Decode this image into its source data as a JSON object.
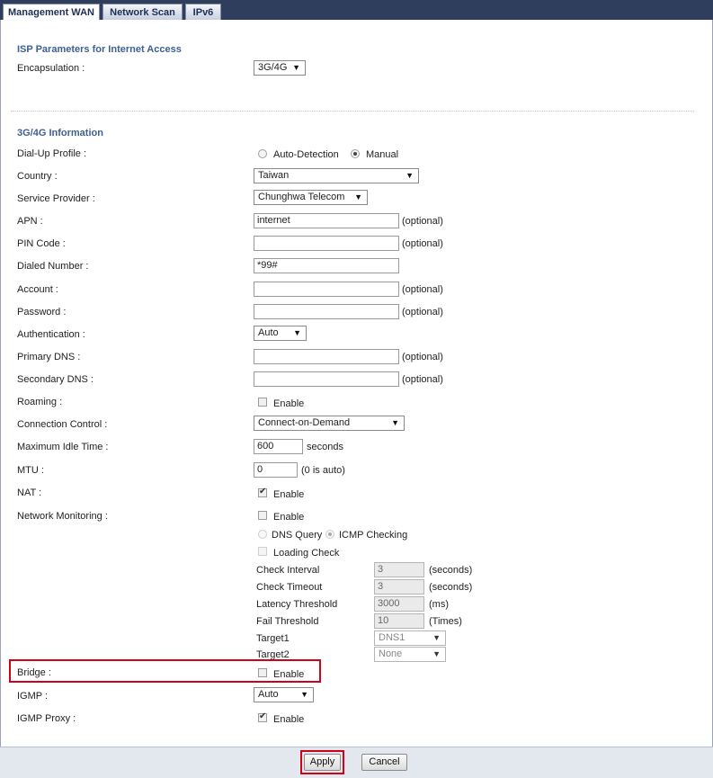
{
  "tabs": [
    {
      "label": "Management WAN",
      "active": true
    },
    {
      "label": "Network Scan",
      "active": false
    },
    {
      "label": "IPv6",
      "active": false
    }
  ],
  "isp": {
    "title": "ISP Parameters for Internet Access",
    "encapsulation_label": "Encapsulation :",
    "encapsulation_value": "3G/4G"
  },
  "info": {
    "title": "3G/4G Information",
    "dialup_label": "Dial-Up Profile :",
    "dialup_auto": "Auto-Detection",
    "dialup_manual": "Manual",
    "country_label": "Country :",
    "country_value": "Taiwan",
    "provider_label": "Service Provider :",
    "provider_value": "Chunghwa Telecom",
    "apn_label": "APN :",
    "apn_value": "internet",
    "pin_label": "PIN Code :",
    "pin_value": "",
    "dialed_label": "Dialed Number :",
    "dialed_value": "*99#",
    "account_label": "Account :",
    "account_value": "",
    "password_label": "Password :",
    "password_value": "",
    "auth_label": "Authentication :",
    "auth_value": "Auto",
    "pdns_label": "Primary DNS :",
    "pdns_value": "",
    "sdns_label": "Secondary DNS :",
    "sdns_value": "",
    "roaming_label": "Roaming :",
    "conn_label": "Connection Control :",
    "conn_value": "Connect-on-Demand",
    "idle_label": "Maximum Idle Time :",
    "idle_value": "600",
    "idle_unit": "seconds",
    "mtu_label": "MTU :",
    "mtu_value": "0",
    "mtu_hint": "(0 is auto)",
    "nat_label": "NAT :",
    "netmon_label": "Network Monitoring :",
    "dns_query": "DNS Query",
    "icmp_checking": "ICMP Checking",
    "loading_check": "Loading Check",
    "check_interval_label": "Check Interval",
    "check_interval_value": "3",
    "check_interval_unit": "(seconds)",
    "check_timeout_label": "Check Timeout",
    "check_timeout_value": "3",
    "check_timeout_unit": "(seconds)",
    "latency_label": "Latency Threshold",
    "latency_value": "3000",
    "latency_unit": "(ms)",
    "fail_label": "Fail Threshold",
    "fail_value": "10",
    "fail_unit": "(Times)",
    "target1_label": "Target1",
    "target1_value": "DNS1",
    "target2_label": "Target2",
    "target2_value": "None",
    "bridge_label": "Bridge :",
    "igmp_label": "IGMP :",
    "igmp_value": "Auto",
    "igmp_proxy_label": "IGMP Proxy :",
    "optional": "(optional)",
    "enable": "Enable"
  },
  "footer": {
    "apply": "Apply",
    "cancel": "Cancel"
  },
  "colors": {
    "tabbar": "#2e3e5c",
    "section_title": "#3f5f93",
    "highlight": "#d0021b"
  }
}
